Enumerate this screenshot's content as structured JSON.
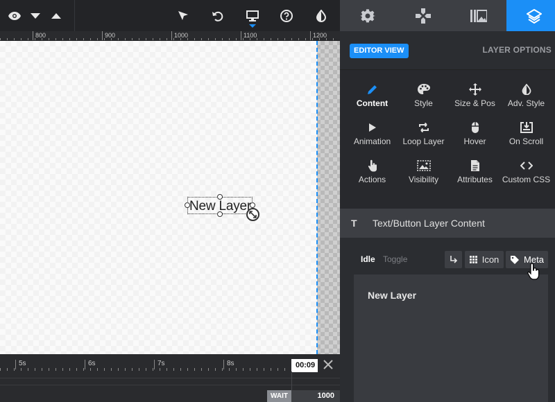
{
  "ruler": {
    "marks": [
      "800",
      "900",
      "1000",
      "1100",
      "1200"
    ]
  },
  "canvas": {
    "layer_text": "New Layer"
  },
  "timeline": {
    "marks": [
      "5s",
      "6s",
      "7s",
      "8s"
    ],
    "current_time": "00:09",
    "wait_label": "WAIT",
    "wait_value": "1000"
  },
  "panel": {
    "editor_view": "EDITOR VIEW",
    "layer_options": "LAYER OPTIONS",
    "grid": [
      {
        "label": "Content",
        "icon": "pencil-icon"
      },
      {
        "label": "Style",
        "icon": "palette-icon"
      },
      {
        "label": "Size & Pos",
        "icon": "move-icon"
      },
      {
        "label": "Adv. Style",
        "icon": "contrast-icon"
      },
      {
        "label": "Animation",
        "icon": "play-icon"
      },
      {
        "label": "Loop Layer",
        "icon": "loop-icon"
      },
      {
        "label": "Hover",
        "icon": "mouse-icon"
      },
      {
        "label": "On Scroll",
        "icon": "download-box-icon"
      },
      {
        "label": "Actions",
        "icon": "pointer-hand-icon"
      },
      {
        "label": "Visibility",
        "icon": "image-dotted-icon"
      },
      {
        "label": "Attributes",
        "icon": "document-icon"
      },
      {
        "label": "Custom CSS",
        "icon": "code-icon"
      }
    ],
    "section_title": "Text/Button Layer Content",
    "section_icon": "T",
    "tabs": {
      "idle": "Idle",
      "toggle": "Toggle"
    },
    "buttons": {
      "icon": "Icon",
      "meta": "Meta"
    },
    "text_value": "New Layer"
  },
  "colors": {
    "accent": "#1b8ff7",
    "panel_bg": "#2b2d31",
    "toolbar_bg": "#232427"
  }
}
